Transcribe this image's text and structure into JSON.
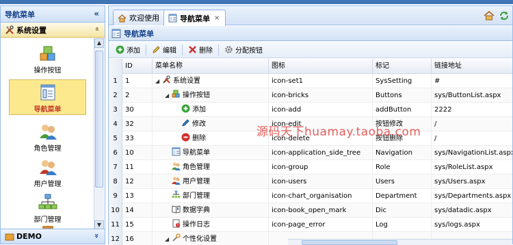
{
  "left_panel": {
    "title": "导航菜单",
    "collapse_glyph": "«",
    "sections": [
      {
        "label": "系统设置",
        "expanded": true,
        "icon": "tools-icon",
        "chevron": "»"
      },
      {
        "label": "DEMO",
        "expanded": false,
        "icon": "folder-icon",
        "chevron": "»"
      }
    ],
    "nav_items": [
      {
        "label": "操作按钮",
        "icon": "bricks-icon",
        "selected": false
      },
      {
        "label": "导航菜单",
        "icon": "application-tree-icon",
        "selected": true
      },
      {
        "label": "角色管理",
        "icon": "group-icon",
        "selected": false
      },
      {
        "label": "用户管理",
        "icon": "users-icon",
        "selected": false
      },
      {
        "label": "部门管理",
        "icon": "chart-organisation-icon",
        "selected": false
      }
    ]
  },
  "tabs": [
    {
      "label": "欢迎使用",
      "icon": "home-icon",
      "active": false,
      "closable": false
    },
    {
      "label": "导航菜单",
      "icon": "application-tree-icon",
      "active": true,
      "closable": true,
      "close_glyph": "×"
    }
  ],
  "tab_tools": [
    "home-icon",
    "refresh-icon"
  ],
  "panel": {
    "title": "导航菜单"
  },
  "toolbar": {
    "add": "添加",
    "edit": "编辑",
    "delete": "删除",
    "assign": "分配按钮"
  },
  "grid": {
    "columns": [
      "ID",
      "菜单名称",
      "图标",
      "标记",
      "链接地址"
    ],
    "rows": [
      {
        "n": "1",
        "id": "1",
        "name": "系统设置",
        "level": 0,
        "expander": "◢",
        "icon_name": "tools-icon",
        "icon": "icon-set1",
        "tag": "SysSetting",
        "url": "#"
      },
      {
        "n": "2",
        "id": "2",
        "name": "操作按钮",
        "level": 1,
        "expander": "◢",
        "icon_name": "bricks-icon",
        "icon": "icon-bricks",
        "tag": "Buttons",
        "url": "sys/ButtonList.aspx"
      },
      {
        "n": "3",
        "id": "30",
        "name": "添加",
        "level": 2,
        "expander": "",
        "icon_name": "add-icon",
        "icon": "icon-add",
        "tag": "addButton",
        "url": "2222"
      },
      {
        "n": "4",
        "id": "32",
        "name": "修改",
        "level": 2,
        "expander": "",
        "icon_name": "pencil-icon",
        "icon": "icon-edit",
        "tag": "按钮修改",
        "url": "/"
      },
      {
        "n": "5",
        "id": "33",
        "name": "删除",
        "level": 2,
        "expander": "",
        "icon_name": "delete-icon",
        "icon": "icon-delete",
        "tag": "按钮删除",
        "url": "/"
      },
      {
        "n": "6",
        "id": "10",
        "name": "导航菜单",
        "level": 1,
        "expander": "",
        "icon_name": "application-tree-icon",
        "icon": "icon-application_side_tree",
        "tag": "Navigation",
        "url": "sys/NavigationList.aspx"
      },
      {
        "n": "7",
        "id": "11",
        "name": "角色管理",
        "level": 1,
        "expander": "",
        "icon_name": "group-icon",
        "icon": "icon-group",
        "tag": "Role",
        "url": "sys/RoleList.aspx"
      },
      {
        "n": "8",
        "id": "12",
        "name": "用户管理",
        "level": 1,
        "expander": "",
        "icon_name": "users-icon",
        "icon": "icon-users",
        "tag": "Users",
        "url": "sys/Users.aspx"
      },
      {
        "n": "9",
        "id": "13",
        "name": "部门管理",
        "level": 1,
        "expander": "",
        "icon_name": "chart-organisation-icon",
        "icon": "icon-chart_organisation",
        "tag": "Department",
        "url": "sys/Departments.aspx"
      },
      {
        "n": "10",
        "id": "14",
        "name": "数据字典",
        "level": 1,
        "expander": "",
        "icon_name": "book-icon",
        "icon": "icon-book_open_mark",
        "tag": "Dic",
        "url": "sys/datadic.aspx"
      },
      {
        "n": "11",
        "id": "15",
        "name": "操作日志",
        "level": 1,
        "expander": "",
        "icon_name": "page-error-icon",
        "icon": "icon-page_error",
        "tag": "Log",
        "url": "sys/logs.aspx"
      },
      {
        "n": "12",
        "id": "16",
        "name": "个性化设置",
        "level": 1,
        "expander": "◢",
        "icon_name": "wrench-icon",
        "icon": "",
        "tag": "",
        "url": ""
      }
    ]
  },
  "watermark": "源码天下huamay.taoba.com",
  "scroll_glyphs": {
    "up": "▲",
    "down": "▼"
  },
  "colors": {
    "accent": "#15428b",
    "border": "#99bbe8",
    "selected": "#fde98d",
    "watermark": "#de2828"
  }
}
